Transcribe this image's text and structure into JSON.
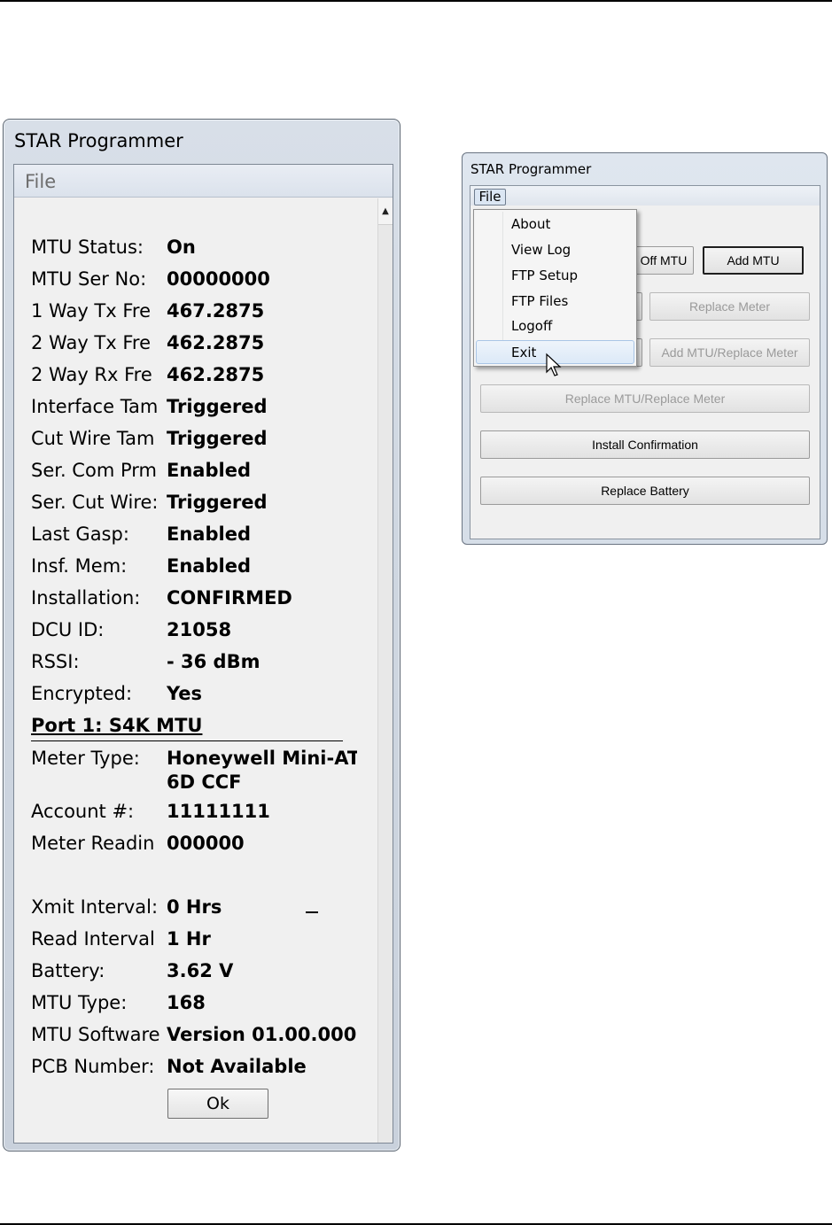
{
  "left_window": {
    "title": "STAR Programmer",
    "menu_file": "File",
    "rows": [
      {
        "label": "MTU Status:",
        "value": "On"
      },
      {
        "label": "MTU Ser No:",
        "value": "00000000"
      },
      {
        "label": "1 Way Tx Fre",
        "value": "467.2875"
      },
      {
        "label": "2 Way Tx Fre",
        "value": "462.2875"
      },
      {
        "label": "2 Way Rx Fre",
        "value": "462.2875"
      },
      {
        "label": "Interface Tam",
        "value": "Triggered"
      },
      {
        "label": "Cut Wire Tam",
        "value": "Triggered"
      },
      {
        "label": "Ser. Com Prm",
        "value": "Enabled"
      },
      {
        "label": "Ser. Cut Wire:",
        "value": "Triggered"
      },
      {
        "label": "Last Gasp:",
        "value": "Enabled"
      },
      {
        "label": "Insf. Mem:",
        "value": "Enabled"
      },
      {
        "label": "Installation:",
        "value": "CONFIRMED"
      },
      {
        "label": "DCU ID:",
        "value": "21058"
      },
      {
        "label": "RSSI:",
        "value": "- 36 dBm"
      },
      {
        "label": "Encrypted:",
        "value": "Yes"
      }
    ],
    "port_header": "Port 1: S4K MTU",
    "port_rows": [
      {
        "label": "Meter Type:",
        "value": "Honeywell Mini-AT",
        "value2": "6D CCF"
      },
      {
        "label": "Account #:",
        "value": "11111111"
      },
      {
        "label": "Meter Readin",
        "value": "000000"
      }
    ],
    "lower_rows": [
      {
        "label": "Xmit Interval:",
        "value": "0 Hrs"
      },
      {
        "label": "Read Interval",
        "value": "1 Hr"
      },
      {
        "label": "Battery:",
        "value": "3.62 V"
      },
      {
        "label": "MTU Type:",
        "value": "168"
      },
      {
        "label": "MTU Software",
        "value": "Version 01.00.000"
      },
      {
        "label": "PCB Number:",
        "value": "Not Available"
      }
    ],
    "ok_label": "Ok"
  },
  "right_window": {
    "title": "STAR Programmer",
    "menu_file": "File",
    "buttons": {
      "off_mtu": "Off MTU",
      "add_mtu": "Add MTU",
      "replace_meter": "Replace Meter",
      "add_mtu_replace_meter": "Add MTU/Replace Meter",
      "replace_mtu_replace_meter": "Replace MTU/Replace Meter",
      "install_confirmation": "Install Confirmation",
      "replace_battery": "Replace Battery"
    },
    "file_menu": [
      "About",
      "View Log",
      "FTP Setup",
      "FTP Files",
      "Logoff",
      "Exit"
    ],
    "hovered_item": "Exit"
  }
}
